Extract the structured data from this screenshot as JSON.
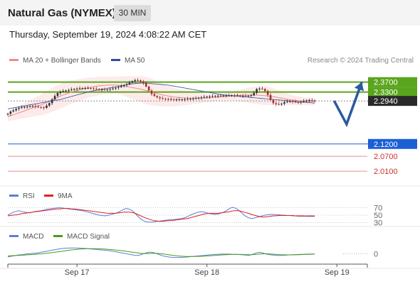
{
  "header": {
    "title": "Natural Gas (NYMEX)",
    "timeframe": "30 MIN"
  },
  "timestamp": "Thursday, September 19, 2024 4:08:22 AM CET",
  "credit": "Research © 2024 Trading Central",
  "legends": {
    "price": [
      {
        "label": "MA 20 + Bollinger Bands",
        "color": "#f08a8a"
      },
      {
        "label": "MA 50",
        "color": "#2b4f9e"
      }
    ],
    "rsi": [
      {
        "label": "RSI",
        "color": "#5a7fd6"
      },
      {
        "label": "9MA",
        "color": "#e02020"
      }
    ],
    "macd": [
      {
        "label": "MACD",
        "color": "#5a7fd6"
      },
      {
        "label": "MACD Signal",
        "color": "#4a9a1a"
      }
    ]
  },
  "chart_data": [
    {
      "type": "candlestick",
      "panel": "price",
      "ylim": [
        1.97,
        2.415
      ],
      "x_range": [
        0,
        130
      ],
      "x_ticks": [
        {
          "x": 25,
          "label": "Sep 17"
        },
        {
          "x": 72,
          "label": "Sep 18"
        },
        {
          "x": 119,
          "label": "Sep 19"
        }
      ],
      "close": [
        2.242,
        2.251,
        2.256,
        2.262,
        2.266,
        2.268,
        2.27,
        2.271,
        2.272,
        2.274,
        2.271,
        2.269,
        2.268,
        2.266,
        2.275,
        2.285,
        2.3,
        2.314,
        2.326,
        2.331,
        2.334,
        2.336,
        2.338,
        2.341,
        2.342,
        2.344,
        2.345,
        2.346,
        2.346,
        2.346,
        2.345,
        2.343,
        2.342,
        2.34,
        2.34,
        2.339,
        2.34,
        2.342,
        2.344,
        2.347,
        2.35,
        2.354,
        2.358,
        2.362,
        2.368,
        2.374,
        2.378,
        2.377,
        2.373,
        2.366,
        2.352,
        2.336,
        2.322,
        2.314,
        2.309,
        2.305,
        2.303,
        2.302,
        2.301,
        2.301,
        2.3,
        2.3,
        2.3,
        2.3,
        2.301,
        2.302,
        2.303,
        2.304,
        2.305,
        2.307,
        2.308,
        2.31,
        2.311,
        2.312,
        2.313,
        2.314,
        2.315,
        2.315,
        2.316,
        2.316,
        2.316,
        2.317,
        2.316,
        2.316,
        2.315,
        2.315,
        2.314,
        2.315,
        2.317,
        2.326,
        2.342,
        2.344,
        2.342,
        2.334,
        2.318,
        2.298,
        2.285,
        2.281,
        2.28,
        2.283,
        2.289,
        2.292,
        2.293,
        2.291,
        2.289,
        2.288,
        2.29,
        2.293,
        2.296,
        2.297,
        2.296,
        2.294
      ],
      "series": [
        {
          "name": "MA 20",
          "values": [
            2.23,
            2.234,
            2.238,
            2.242,
            2.246,
            2.25,
            2.254,
            2.258,
            2.262,
            2.266,
            2.27,
            2.274,
            2.278,
            2.283,
            2.288,
            2.293,
            2.298,
            2.303,
            2.308,
            2.313,
            2.318,
            2.322,
            2.326,
            2.33,
            2.333,
            2.336,
            2.339,
            2.342,
            2.345,
            2.347,
            2.349,
            2.351,
            2.353,
            2.355,
            2.356,
            2.357,
            2.358,
            2.358,
            2.358,
            2.358,
            2.357,
            2.356,
            2.354,
            2.352,
            2.35,
            2.348,
            2.346,
            2.344,
            2.342,
            2.339,
            2.336,
            2.333,
            2.33,
            2.327,
            2.324,
            2.321,
            2.318,
            2.316,
            2.314,
            2.312,
            2.31,
            2.309,
            2.308,
            2.307,
            2.306,
            2.306,
            2.305,
            2.305,
            2.305,
            2.305,
            2.305,
            2.306,
            2.306,
            2.307,
            2.307,
            2.308,
            2.309,
            2.31,
            2.311,
            2.312,
            2.313,
            2.314,
            2.315,
            2.316,
            2.316,
            2.317,
            2.317,
            2.317,
            2.317,
            2.317,
            2.317,
            2.317,
            2.316,
            2.315,
            2.314,
            2.313,
            2.311,
            2.309,
            2.307,
            2.305,
            2.303,
            2.301,
            2.299,
            2.297,
            2.296,
            2.295,
            2.294,
            2.293,
            2.292,
            2.292,
            2.291,
            2.291
          ]
        },
        {
          "name": "MA 50",
          "values": [
            2.262,
            2.264,
            2.266,
            2.268,
            2.27,
            2.272,
            2.274,
            2.276,
            2.278,
            2.28,
            2.282,
            2.284,
            2.286,
            2.288,
            2.29,
            2.292,
            2.294,
            2.296,
            2.298,
            2.3,
            2.303,
            2.306,
            2.309,
            2.312,
            2.315,
            2.318,
            2.321,
            2.324,
            2.327,
            2.33,
            2.333,
            2.335,
            2.337,
            2.339,
            2.341,
            2.343,
            2.345,
            2.347,
            2.349,
            2.351,
            2.353,
            2.355,
            2.357,
            2.359,
            2.361,
            2.363,
            2.364,
            2.365,
            2.366,
            2.366,
            2.366,
            2.365,
            2.364,
            2.363,
            2.362,
            2.361,
            2.36,
            2.359,
            2.358,
            2.356,
            2.354,
            2.352,
            2.35,
            2.348,
            2.346,
            2.344,
            2.342,
            2.34,
            2.338,
            2.336,
            2.334,
            2.332,
            2.33,
            2.328,
            2.326,
            2.324,
            2.322,
            2.32,
            2.318,
            2.317,
            2.316,
            2.315,
            2.314,
            2.313,
            2.312,
            2.311,
            2.31,
            2.309,
            2.308,
            2.307,
            2.306,
            2.305,
            2.304,
            2.303,
            2.302,
            2.301,
            2.3,
            2.299,
            2.298,
            2.297,
            2.296,
            2.295,
            2.294,
            2.293,
            2.292,
            2.291,
            2.29,
            2.289,
            2.288,
            2.287,
            2.286,
            2.285
          ]
        }
      ],
      "bollinger_width": [
        0.018,
        0.02,
        0.022,
        0.024,
        0.026,
        0.028,
        0.03,
        0.032,
        0.034,
        0.036,
        0.038,
        0.04,
        0.042,
        0.044,
        0.046,
        0.047,
        0.048,
        0.049,
        0.05,
        0.05,
        0.05,
        0.049,
        0.048,
        0.047,
        0.046,
        0.045,
        0.044,
        0.043,
        0.042,
        0.041,
        0.04,
        0.039,
        0.038,
        0.037,
        0.036,
        0.035,
        0.034,
        0.034,
        0.034,
        0.035,
        0.036,
        0.038,
        0.04,
        0.042,
        0.044,
        0.046,
        0.048,
        0.05,
        0.052,
        0.054,
        0.055,
        0.055,
        0.054,
        0.052,
        0.05,
        0.048,
        0.046,
        0.044,
        0.042,
        0.04,
        0.038,
        0.036,
        0.034,
        0.032,
        0.03,
        0.028,
        0.026,
        0.024,
        0.022,
        0.021,
        0.02,
        0.019,
        0.018,
        0.017,
        0.017,
        0.016,
        0.016,
        0.016,
        0.016,
        0.016,
        0.017,
        0.018,
        0.02,
        0.022,
        0.024,
        0.026,
        0.028,
        0.03,
        0.032,
        0.034,
        0.036,
        0.037,
        0.038,
        0.038,
        0.037,
        0.036,
        0.034,
        0.032,
        0.03,
        0.028,
        0.026,
        0.024,
        0.022,
        0.02,
        0.019,
        0.018,
        0.017,
        0.016,
        0.016,
        0.015,
        0.015,
        0.015
      ],
      "levels": [
        {
          "value": 2.37,
          "label": "2.3700",
          "style": "resistance",
          "line": "#5aa51e",
          "bg": "#5aa51e"
        },
        {
          "value": 2.33,
          "label": "2.3300",
          "style": "resistance",
          "line": "#5aa51e",
          "bg": "#5aa51e"
        },
        {
          "value": 2.294,
          "label": "2.2940",
          "style": "last",
          "line": "#8c8c8c",
          "bg": "#2a2a2a"
        },
        {
          "value": 2.12,
          "label": "2.1200",
          "style": "support",
          "line": "#1a5fd6",
          "bg": "#1a5fd6"
        },
        {
          "value": 2.07,
          "label": "2.0700",
          "style": "support-thin",
          "line": "#e88c8c",
          "bg": null
        },
        {
          "value": 2.01,
          "label": "2.0100",
          "style": "support-thin",
          "line": "#e88c8c",
          "bg": null
        }
      ],
      "scenario_path": [
        {
          "x": 118,
          "y": 2.294
        },
        {
          "x": 122.5,
          "y": 2.2
        },
        {
          "x": 128,
          "y": 2.37
        }
      ],
      "scenario_color": "#2b5aa0"
    },
    {
      "type": "line",
      "panel": "rsi",
      "ylim": [
        25,
        75
      ],
      "y_ticks": [
        70,
        50,
        30
      ],
      "series": [
        {
          "name": "RSI",
          "values": [
            50,
            54,
            58,
            60,
            62,
            60,
            58,
            57,
            56,
            58,
            60,
            61,
            62,
            64,
            66,
            67,
            68,
            69,
            70,
            70,
            69,
            68,
            67,
            66,
            65,
            64,
            63,
            62,
            60,
            58,
            56,
            54,
            52,
            50,
            49,
            48,
            49,
            51,
            53,
            55,
            58,
            62,
            66,
            68,
            66,
            62,
            55,
            47,
            40,
            35,
            32,
            31,
            31,
            32,
            33,
            34,
            35,
            36,
            37,
            38,
            38,
            39,
            40,
            41,
            43,
            46,
            50,
            53,
            56,
            58,
            59,
            58,
            56,
            54,
            53,
            52,
            53,
            55,
            58,
            62,
            67,
            71,
            70,
            66,
            60,
            53,
            47,
            43,
            41,
            42,
            44,
            46,
            48,
            50,
            51,
            52,
            52,
            51,
            51,
            50,
            50,
            49,
            49,
            48,
            48,
            47,
            47,
            47,
            48,
            48,
            48,
            48
          ]
        },
        {
          "name": "9MA",
          "values": [
            48,
            49,
            50,
            51,
            52,
            54,
            55,
            56,
            57,
            58,
            59,
            60,
            61,
            62,
            63,
            64,
            65,
            66,
            67,
            67,
            68,
            68,
            68,
            67,
            67,
            66,
            65,
            64,
            63,
            62,
            61,
            60,
            59,
            58,
            57,
            56,
            55,
            55,
            55,
            55,
            56,
            57,
            58,
            58,
            58,
            57,
            55,
            52,
            48,
            45,
            42,
            39,
            37,
            35,
            34,
            33,
            33,
            34,
            35,
            35,
            36,
            37,
            38,
            39,
            40,
            41,
            43,
            45,
            47,
            49,
            51,
            53,
            54,
            55,
            55,
            55,
            55,
            56,
            57,
            58,
            59,
            61,
            62,
            62,
            61,
            59,
            57,
            55,
            52,
            50,
            48,
            46,
            45,
            45,
            46,
            47,
            48,
            48,
            49,
            49,
            49,
            49,
            49,
            49,
            48,
            48,
            48,
            48,
            47,
            47,
            47,
            47
          ]
        }
      ]
    },
    {
      "type": "line",
      "panel": "macd",
      "ylim": [
        -0.02,
        0.02
      ],
      "y_ticks": [
        0
      ],
      "series": [
        {
          "name": "MACD",
          "values": [
            -0.006,
            -0.005,
            -0.004,
            -0.003,
            -0.002,
            -0.002,
            -0.001,
            0.0,
            0.0,
            0.001,
            0.001,
            0.002,
            0.003,
            0.004,
            0.005,
            0.006,
            0.007,
            0.008,
            0.009,
            0.01,
            0.0105,
            0.011,
            0.0112,
            0.0113,
            0.0113,
            0.0112,
            0.011,
            0.0108,
            0.0105,
            0.01,
            0.0095,
            0.009,
            0.0085,
            0.008,
            0.0075,
            0.007,
            0.0065,
            0.006,
            0.005,
            0.004,
            0.003,
            0.002,
            0.001,
            0.0,
            -0.001,
            -0.002,
            -0.003,
            -0.003,
            -0.002,
            0.0,
            0.002,
            0.003,
            0.003,
            0.002,
            0.0,
            -0.002,
            -0.004,
            -0.005,
            -0.006,
            -0.0065,
            -0.007,
            -0.007,
            -0.007,
            -0.0068,
            -0.0065,
            -0.006,
            -0.0055,
            -0.005,
            -0.0045,
            -0.004,
            -0.0035,
            -0.003,
            -0.0025,
            -0.002,
            -0.0015,
            -0.001,
            -0.0008,
            -0.0006,
            -0.0005,
            -0.0005,
            -0.0006,
            -0.0008,
            -0.001,
            -0.0012,
            -0.0015,
            -0.002,
            -0.0025,
            -0.003,
            -0.002,
            0.0,
            0.002,
            0.003,
            0.002,
            0.0,
            -0.001,
            -0.002,
            -0.0025,
            -0.003,
            -0.003,
            -0.003,
            -0.0028,
            -0.0025,
            -0.002,
            -0.0018,
            -0.0015,
            -0.0012,
            -0.001,
            -0.0008,
            -0.0006,
            -0.0005,
            -0.0004,
            -0.0003
          ]
        },
        {
          "name": "MACD Signal",
          "values": [
            -0.004,
            -0.0038,
            -0.0035,
            -0.0032,
            -0.003,
            -0.0027,
            -0.0024,
            -0.002,
            -0.0016,
            -0.0012,
            -0.0008,
            -0.0004,
            0.0,
            0.0005,
            0.001,
            0.0016,
            0.0023,
            0.003,
            0.0038,
            0.0046,
            0.0054,
            0.0062,
            0.0069,
            0.0076,
            0.0082,
            0.0087,
            0.0091,
            0.0095,
            0.0098,
            0.01,
            0.0101,
            0.0101,
            0.01,
            0.0098,
            0.0095,
            0.0092,
            0.0088,
            0.0084,
            0.0079,
            0.0074,
            0.0068,
            0.0062,
            0.0055,
            0.0048,
            0.004,
            0.0032,
            0.0024,
            0.0016,
            0.001,
            0.0006,
            0.0005,
            0.0006,
            0.0008,
            0.0009,
            0.0008,
            0.0005,
            0.0,
            -0.0008,
            -0.0016,
            -0.0024,
            -0.0032,
            -0.0038,
            -0.0043,
            -0.0047,
            -0.005,
            -0.0052,
            -0.0053,
            -0.0053,
            -0.0052,
            -0.005,
            -0.0048,
            -0.0045,
            -0.0042,
            -0.0038,
            -0.0034,
            -0.003,
            -0.0026,
            -0.0022,
            -0.0019,
            -0.0016,
            -0.0014,
            -0.0012,
            -0.0011,
            -0.0011,
            -0.0012,
            -0.0013,
            -0.0015,
            -0.0017,
            -0.0017,
            -0.0014,
            -0.0009,
            -0.0003,
            0.0,
            0.0001,
            0.0,
            -0.0003,
            -0.0007,
            -0.0011,
            -0.0015,
            -0.0018,
            -0.002,
            -0.0021,
            -0.0021,
            -0.002,
            -0.0019,
            -0.0017,
            -0.0015,
            -0.0013,
            -0.0011,
            -0.0009,
            -0.0007,
            -0.0005
          ]
        }
      ]
    }
  ]
}
